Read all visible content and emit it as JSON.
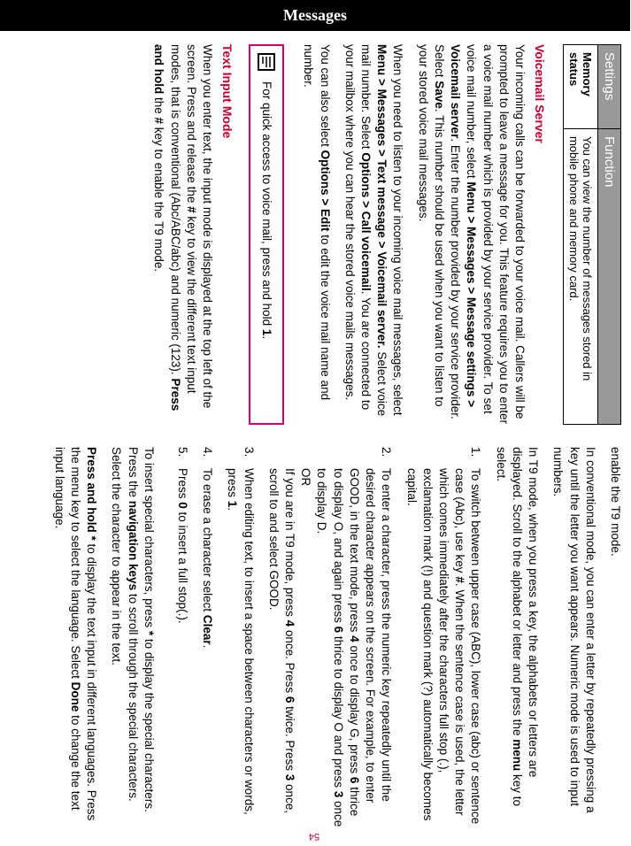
{
  "side_tab": "Messages",
  "page_number": "54",
  "table": {
    "h1": "Settings",
    "h2": "Function",
    "c1": "Memory status",
    "c2": "You can view the number of messages stored in mobile phone and memory card."
  },
  "voicemail": {
    "heading": "Voicemail Server",
    "p1_a": "Your incoming calls can be forwarded to your voice mail. Callers will be prompted to leave a message for you. This feature requires you to enter a voice mail number which is provided by your service provider. To set voice mail number, select ",
    "p1_b1": "Menu > Messages > Message settings > Voicemail server",
    "p1_c": ". Enter the number provided by your service provider. Select ",
    "p1_b2": "Save",
    "p1_d": ". This number should be used when you want to listen to your stored voice mail messages.",
    "p2_a": "When you need to listen to your incoming voice mail messages, select ",
    "p2_b1": "Menu > Messages > Text message > Voicemail server.",
    "p2_b": "  Select voice mail number. Select ",
    "p2_b2": "Options > Call voicemail",
    "p2_c": ". You are connected to your mailbox where you can hear the stored voice mails messages.",
    "p3_a": "You can also select ",
    "p3_b1": "Options > Edit",
    "p3_b": " to edit the voice mail name and number.",
    "note_a": "For quick access to voice mail, press and hold ",
    "note_b": "1",
    "note_c": "."
  },
  "text_input": {
    "heading": "Text Input Mode",
    "p1_a": "When you enter text, the input mode is displayed at the top left of the screen. Press and release the ",
    "p1_b1": "#",
    "p1_b": " key to view the different text input modes, that is conventional (Abc/ABC/abc) and numeric (123). ",
    "p1_b2": "Press and hold",
    "p1_c": " the ",
    "p1_b3": "#",
    "p1_d": " key to enable the T9 mode.",
    "p2": "In conventional mode, you can enter a letter by repeatedly pressing a key until the letter you want appears. Numeric mode is used to input numbers.",
    "p3_a": "In T9 mode, when you press a key, the alphabets or letters are displayed. Scroll to the alphabet or letter and press the ",
    "p3_b1": "menu",
    "p3_b": " key to select.",
    "li1_a": "To switch between upper case (ABC), lower case (abc) or sentence case (Abc), use key ",
    "li1_b1": "#",
    "li1_b": ". When the sentence case is used, the letter which comes immediately after the characters full stop (.), exclamation mark (!) and question mark (?) automatically becomes capital.",
    "li2_a": "To enter a character, press the numeric key repeatedly until the desired character appears on the screen. For example, to enter GOOD, in the text mode, press ",
    "li2_b1": "4",
    "li2_b": " once to display G, press ",
    "li2_b2": "6",
    "li2_c": " thrice to display O, and again press ",
    "li2_b3": "6",
    "li2_d": " thrice to display O and press ",
    "li2_b4": "3",
    "li2_e": " once to display D.",
    "li2_or": "OR",
    "li2_f": "If you are in T9 mode, press ",
    "li2_b5": "4",
    "li2_g": " once. Press ",
    "li2_b6": "6",
    "li2_h": " twice. Press ",
    "li2_b7": "3",
    "li2_i": " once, scroll to and select GOOD.",
    "li3_a": "When editing text, to insert a space between characters or words, press ",
    "li3_b1": "1",
    "li3_b": ".",
    "li4_a": "To erase a character select ",
    "li4_b1": "Clear",
    "li4_b": ".",
    "li5_a": "Press ",
    "li5_b1": "0",
    "li5_b": " to insert a full stop(.).",
    "p4_a": "To insert special characters, press ",
    "p4_b1": "*",
    "p4_b": " to display the special characters. Press the ",
    "p4_b2": "navigation keys",
    "p4_c": " to scroll through the special characters. Select the character to appear in the text.",
    "p5_a": "Press and hold ",
    "p5_b1": "*",
    "p5_b": " to display the text input in different languages. Press the menu key to select the language. Select ",
    "p5_b2": "Done",
    "p5_c": " to change the text input language."
  }
}
